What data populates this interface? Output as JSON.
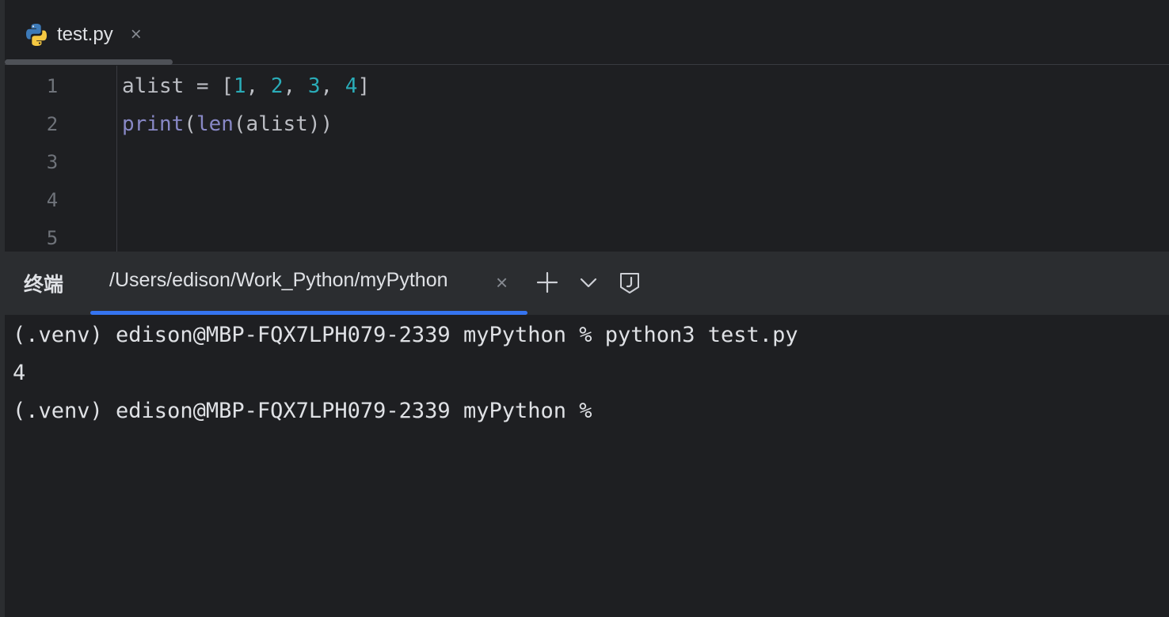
{
  "editor": {
    "tab": {
      "label": "test.py",
      "icon": "python-file-icon",
      "close": "×"
    },
    "line_numbers": [
      "1",
      "2",
      "3",
      "4",
      "5"
    ],
    "code": [
      [
        {
          "t": "alist = [",
          "c": "plain"
        },
        {
          "t": "1",
          "c": "num"
        },
        {
          "t": ", ",
          "c": "plain"
        },
        {
          "t": "2",
          "c": "num"
        },
        {
          "t": ", ",
          "c": "plain"
        },
        {
          "t": "3",
          "c": "num"
        },
        {
          "t": ", ",
          "c": "plain"
        },
        {
          "t": "4",
          "c": "num"
        },
        {
          "t": "]",
          "c": "plain"
        }
      ],
      [
        {
          "t": "print",
          "c": "builtin"
        },
        {
          "t": "(",
          "c": "plain"
        },
        {
          "t": "len",
          "c": "builtin"
        },
        {
          "t": "(alist))",
          "c": "plain"
        }
      ]
    ]
  },
  "terminal": {
    "title": "终端",
    "tab_label": "/Users/edison/Work_Python/myPython",
    "tab_close": "×",
    "actions": [
      {
        "name": "new-terminal-button",
        "icon": "plus-icon"
      },
      {
        "name": "terminal-options-button",
        "icon": "chevron-down-icon"
      },
      {
        "name": "jupyter-button",
        "icon": "jupyter-icon"
      }
    ],
    "lines": [
      "(.venv) edison@MBP-FQX7LPH079-2339 myPython % python3 test.py",
      "4",
      "(.venv) edison@MBP-FQX7LPH079-2339 myPython %"
    ]
  },
  "colors": {
    "background": "#1e1f22",
    "panel": "#2b2d30",
    "accent": "#3574f0",
    "number": "#2aacb8",
    "builtin": "#8888c6"
  }
}
